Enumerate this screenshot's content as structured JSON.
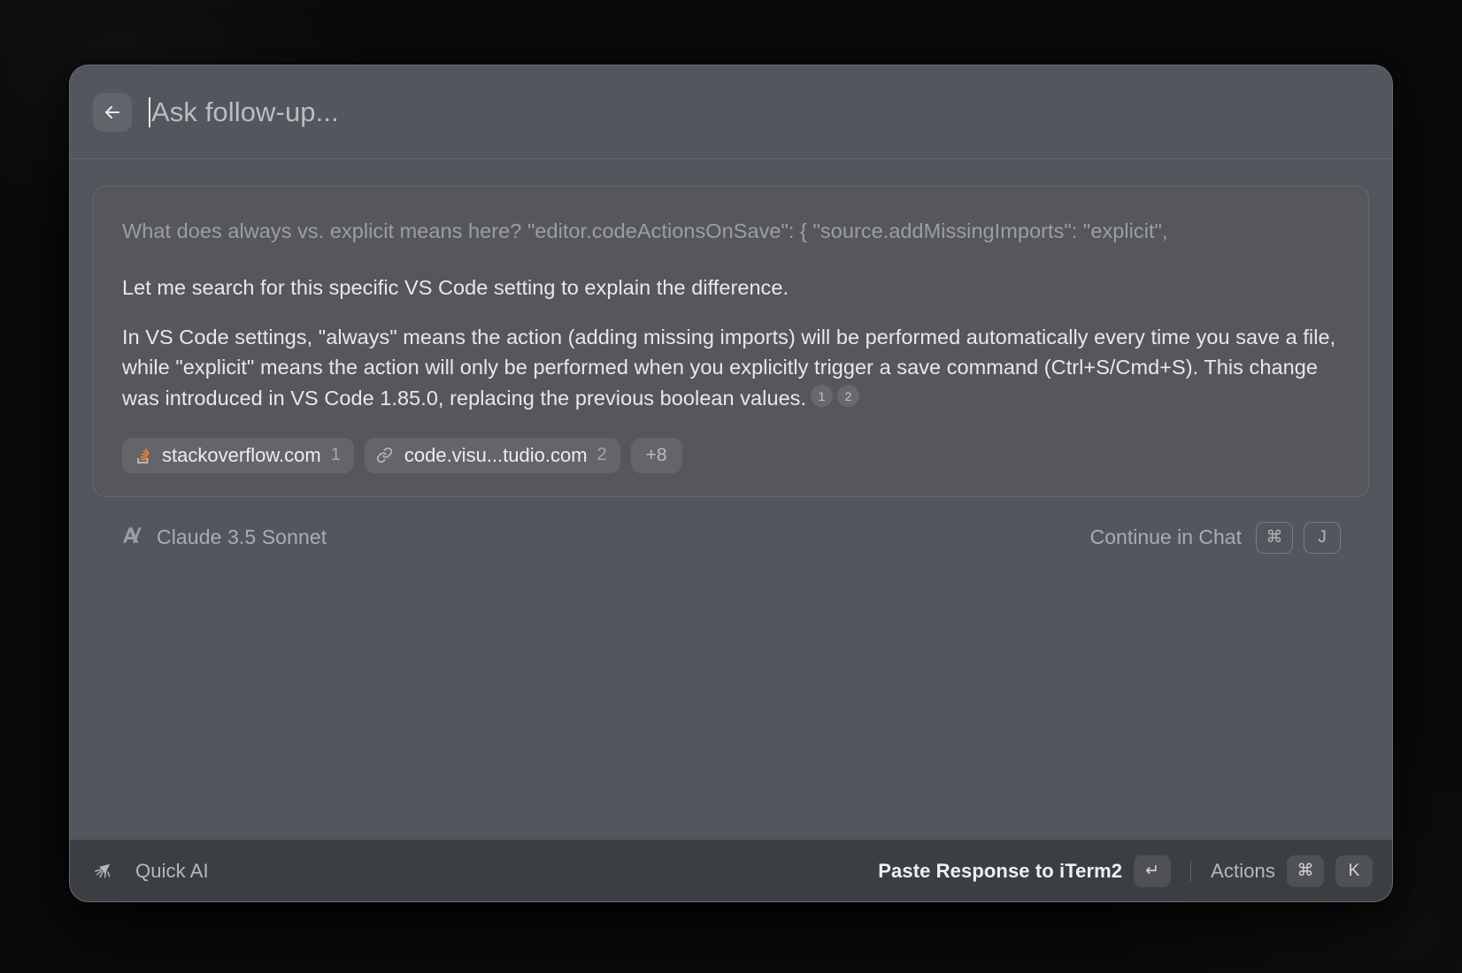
{
  "window": {
    "search": {
      "placeholder": "Ask follow-up...",
      "back_icon": "arrow-left-icon"
    }
  },
  "answer": {
    "question": "What does always vs. explicit means here? \"editor.codeActionsOnSave\": { \"source.addMissingImports\": \"explicit\",",
    "paragraphs": [
      "Let me search for this specific VS Code setting to explain the difference.",
      "In VS Code settings, \"always\" means the action (adding missing imports) will be performed automatically every time you save a file, while \"explicit\" means the action will only be performed when you explicitly trigger a save command (Ctrl+S/Cmd+S). This change was introduced in VS Code 1.85.0, replacing the previous boolean values."
    ],
    "citations": [
      "1",
      "2"
    ],
    "sources": [
      {
        "icon": "stackoverflow-icon",
        "label": "stackoverflow.com",
        "number": "1"
      },
      {
        "icon": "link-icon",
        "label": "code.visu...tudio.com",
        "number": "2"
      }
    ],
    "more_sources": "+8"
  },
  "model_footer": {
    "icon": "anthropic-logo-icon",
    "name": "Claude 3.5 Sonnet",
    "continue_label": "Continue in Chat",
    "keys": [
      "⌘",
      "J"
    ]
  },
  "bottom_bar": {
    "brand_icon": "raycast-quick-ai-icon",
    "brand": "Quick AI",
    "primary_action": "Paste Response to iTerm2",
    "primary_key": "↵",
    "actions_label": "Actions",
    "actions_keys": [
      "⌘",
      "K"
    ]
  },
  "colors": {
    "window_bg": "#53565c",
    "bottom_bar_bg": "#3b3e43",
    "desktop_bg": "#0a0a0b",
    "text_primary": "#e7e8ea",
    "text_muted": "#9b9ea4",
    "stackoverflow_orange": "#f48024"
  }
}
